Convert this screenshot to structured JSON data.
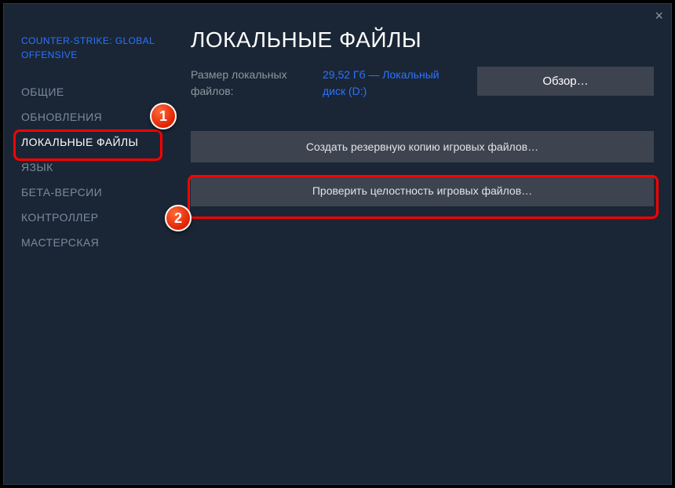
{
  "game_title": "COUNTER-STRIKE: GLOBAL OFFENSIVE",
  "sidebar": {
    "items": [
      {
        "label": "ОБЩИЕ",
        "active": false
      },
      {
        "label": "ОБНОВЛЕНИЯ",
        "active": false
      },
      {
        "label": "ЛОКАЛЬНЫЕ ФАЙЛЫ",
        "active": true
      },
      {
        "label": "ЯЗЫК",
        "active": false
      },
      {
        "label": "БЕТА-ВЕРСИИ",
        "active": false
      },
      {
        "label": "КОНТРОЛЛЕР",
        "active": false
      },
      {
        "label": "МАСТЕРСКАЯ",
        "active": false
      }
    ]
  },
  "page": {
    "title": "ЛОКАЛЬНЫЕ ФАЙЛЫ",
    "size_label": "Размер локальных файлов:",
    "size_value": "29,52 Гб — Локальный диск (D:)",
    "browse_label": "Обзор…",
    "backup_label": "Создать резервную копию игровых файлов…",
    "verify_label": "Проверить целостность игровых файлов…"
  },
  "annotations": {
    "badge1": "1",
    "badge2": "2"
  }
}
